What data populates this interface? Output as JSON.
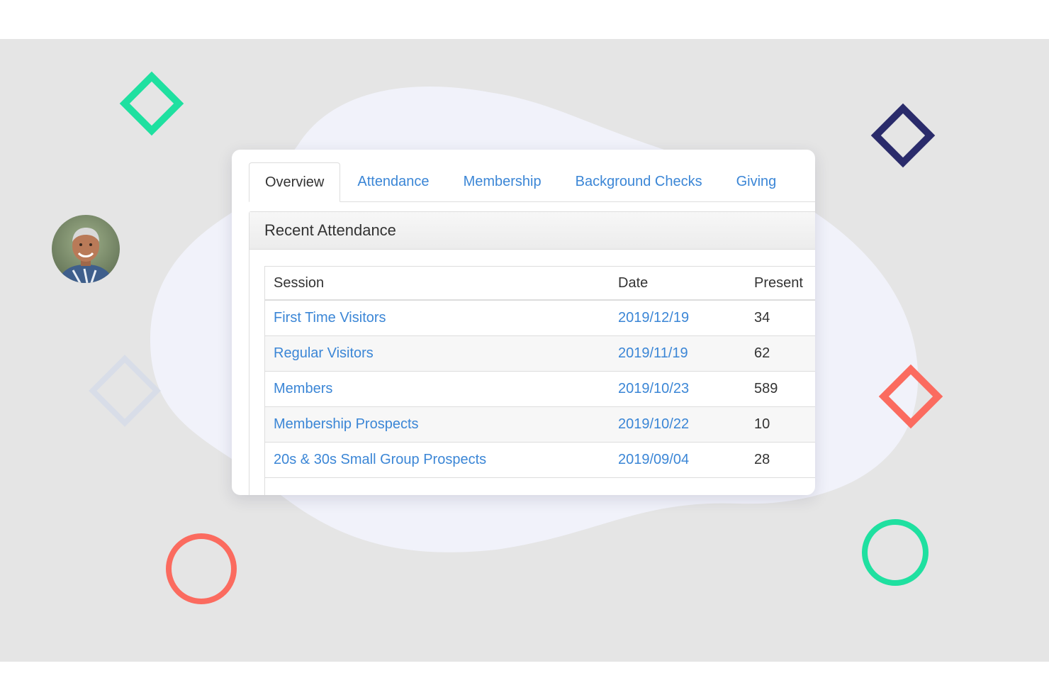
{
  "tabs": [
    {
      "label": "Overview",
      "active": true
    },
    {
      "label": "Attendance",
      "active": false
    },
    {
      "label": "Membership",
      "active": false
    },
    {
      "label": "Background Checks",
      "active": false
    },
    {
      "label": "Giving",
      "active": false
    }
  ],
  "panel": {
    "title": "Recent Attendance"
  },
  "table": {
    "headers": {
      "session": "Session",
      "date": "Date",
      "present": "Present"
    },
    "rows": [
      {
        "session": "First Time Visitors",
        "date": "2019/12/19",
        "present": "34"
      },
      {
        "session": "Regular Visitors",
        "date": "2019/11/19",
        "present": "62"
      },
      {
        "session": "Members",
        "date": "2019/10/23",
        "present": "589"
      },
      {
        "session": "Membership Prospects",
        "date": "2019/10/22",
        "present": "10"
      },
      {
        "session": "20s & 30s Small Group Prospects",
        "date": "2019/09/04",
        "present": "28"
      }
    ]
  },
  "colors": {
    "link": "#3b86d6",
    "green": "#1fe0a0",
    "navy": "#2a2b6b",
    "coral": "#fb6b5f",
    "background": "#e5e5e5",
    "blob": "#f1f2fa"
  }
}
